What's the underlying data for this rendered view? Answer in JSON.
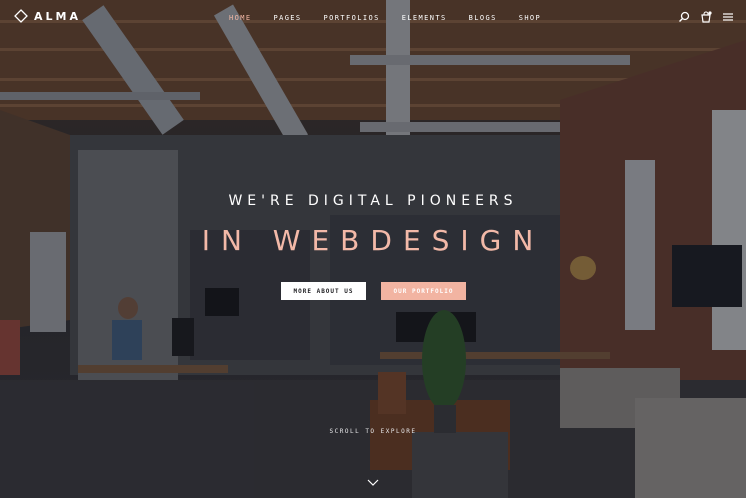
{
  "brand": {
    "name": "ALMA",
    "logo_icon": "diamond-logo-icon"
  },
  "nav": {
    "items": [
      {
        "label": "HOME",
        "active": true
      },
      {
        "label": "PAGES",
        "active": false
      },
      {
        "label": "PORTFOLIOS",
        "active": false
      },
      {
        "label": "ELEMENTS",
        "active": false
      },
      {
        "label": "BLOGS",
        "active": false
      },
      {
        "label": "SHOP",
        "active": false
      }
    ],
    "active_color": "#f2b7a5"
  },
  "tools": {
    "search_icon": "search-icon",
    "cart_icon": "shopping-bag-icon",
    "menu_icon": "hamburger-menu-icon"
  },
  "hero": {
    "tagline": "WE'RE DIGITAL PIONEERS",
    "headline": "IN WEBDESIGN",
    "headline_color": "#f3b9a8",
    "primary_button": "MORE ABOUT US",
    "secondary_button": "OUR PORTFOLIO",
    "secondary_button_color": "#f2b4a2",
    "scroll_label": "SCROLL TO EXPLORE",
    "scroll_icon": "chevron-down-icon",
    "background": "office-interior-photo"
  }
}
